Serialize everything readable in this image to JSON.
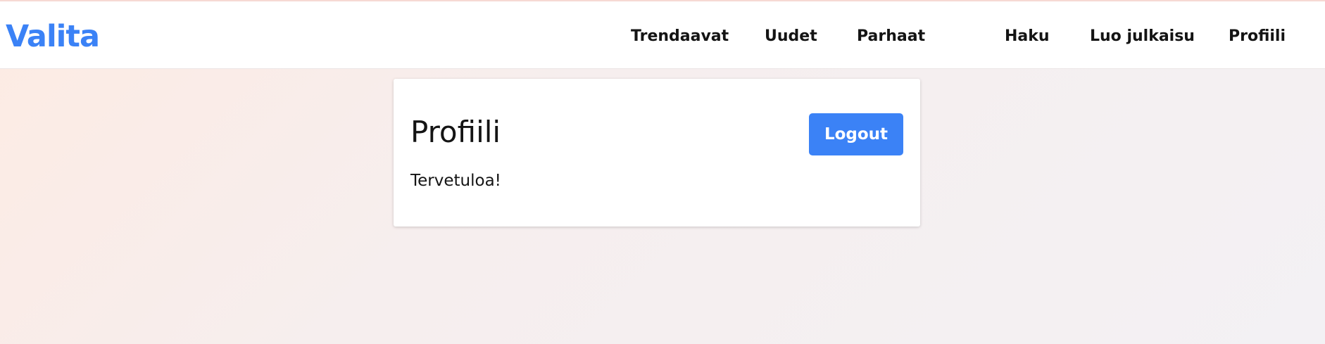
{
  "navbar": {
    "brand": "Valita",
    "links": [
      {
        "label": "Trendaavat"
      },
      {
        "label": "Uudet"
      },
      {
        "label": "Parhaat"
      },
      {
        "label": "Haku"
      },
      {
        "label": "Luo julkaisu"
      },
      {
        "label": "Profiili"
      }
    ]
  },
  "profile_card": {
    "title": "Profiili",
    "logout_label": "Logout",
    "welcome_text": "Tervetuloa!"
  },
  "colors": {
    "accent": "#3b82f6",
    "text": "#141414"
  }
}
